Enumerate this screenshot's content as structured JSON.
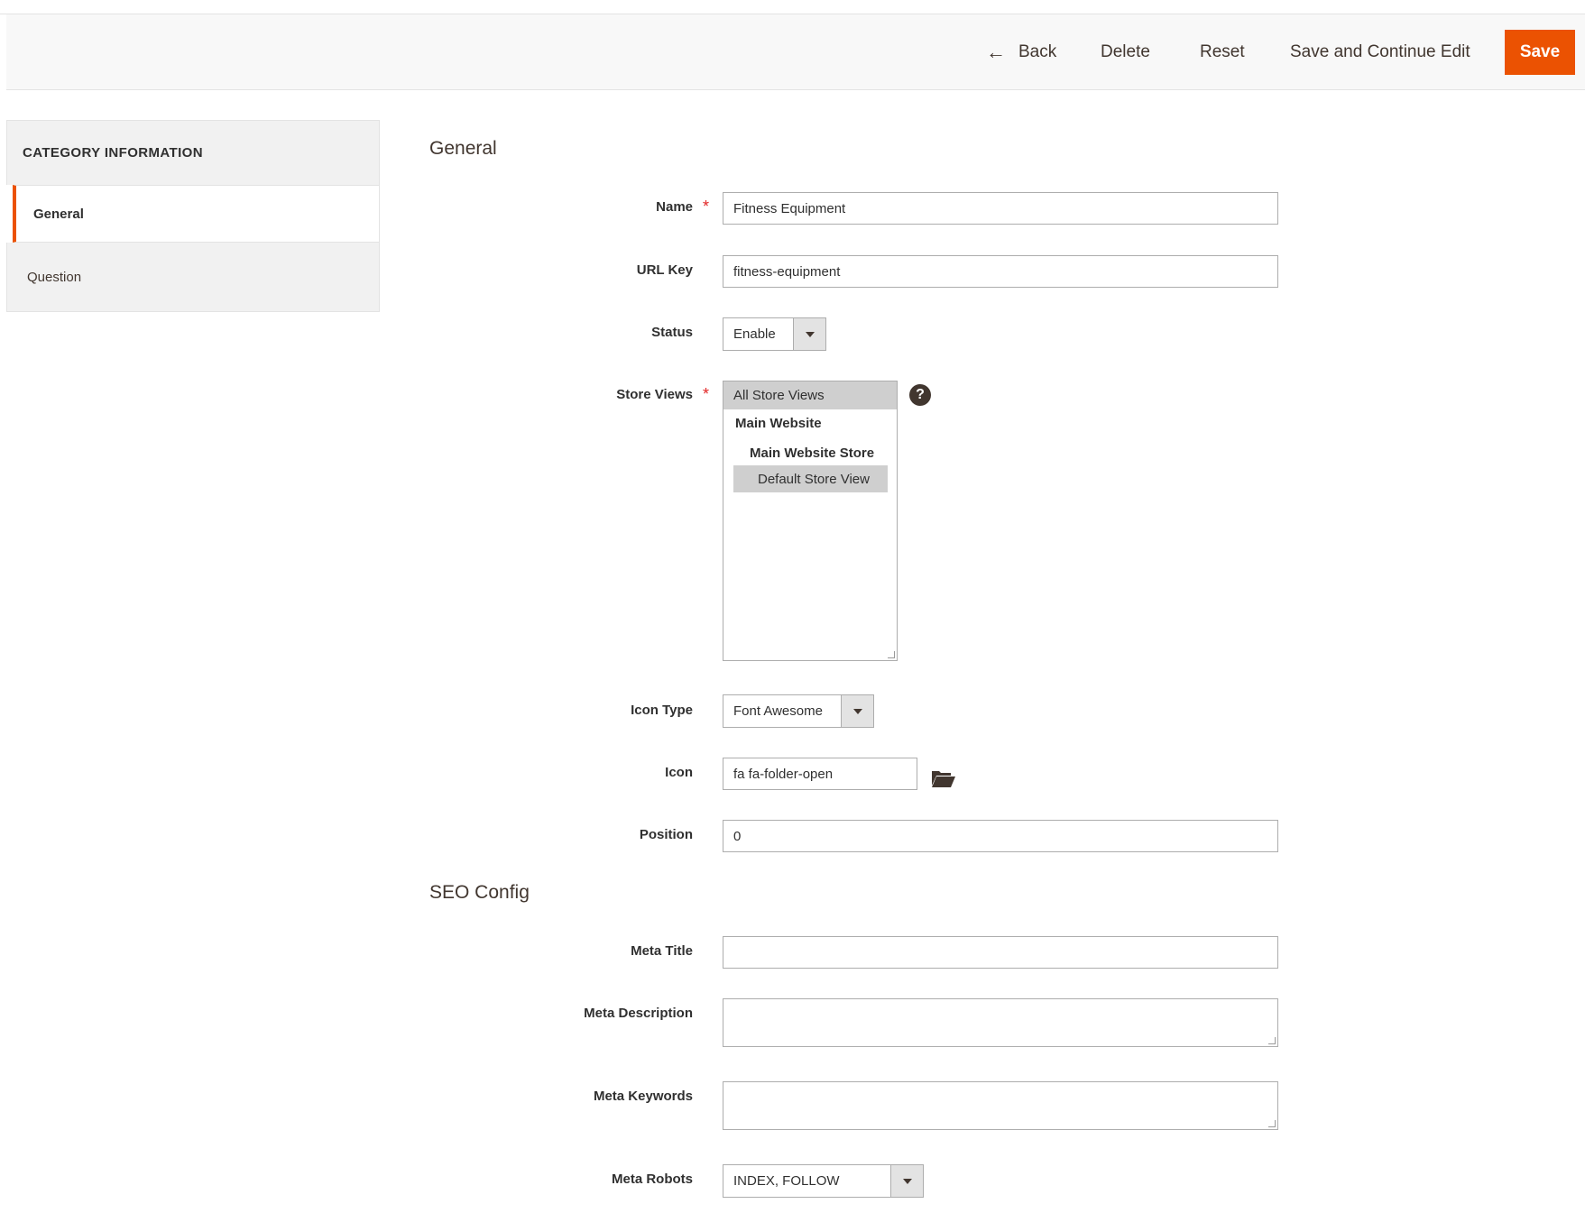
{
  "toolbar": {
    "back_label": "Back",
    "delete_label": "Delete",
    "reset_label": "Reset",
    "save_continue_label": "Save and Continue Edit",
    "save_label": "Save"
  },
  "sidebar": {
    "title": "CATEGORY INFORMATION",
    "items": [
      {
        "label": "General",
        "active": true
      },
      {
        "label": "Question",
        "active": false
      }
    ]
  },
  "sections": {
    "general_title": "General",
    "seo_title": "SEO Config"
  },
  "form": {
    "name": {
      "label": "Name",
      "value": "Fitness Equipment",
      "required": true
    },
    "url_key": {
      "label": "URL Key",
      "value": "fitness-equipment"
    },
    "status": {
      "label": "Status",
      "value": "Enable"
    },
    "store_views": {
      "label": "Store Views",
      "required": true,
      "options": {
        "all": "All Store Views",
        "website": "Main Website",
        "store": "Main Website Store",
        "view": "Default Store View"
      },
      "selected": [
        "All Store Views",
        "Default Store View"
      ],
      "help_icon": "question-circle-icon"
    },
    "icon_type": {
      "label": "Icon Type",
      "value": "Font Awesome"
    },
    "icon": {
      "label": "Icon",
      "value": "fa fa-folder-open",
      "picker_icon": "folder-open-icon"
    },
    "position": {
      "label": "Position",
      "value": "0"
    },
    "meta_title": {
      "label": "Meta Title",
      "value": ""
    },
    "meta_description": {
      "label": "Meta Description",
      "value": ""
    },
    "meta_keywords": {
      "label": "Meta Keywords",
      "value": ""
    },
    "meta_robots": {
      "label": "Meta Robots",
      "value": "INDEX, FOLLOW"
    }
  },
  "colors": {
    "accent": "#eb5202",
    "required": "#e22626",
    "text": "#303030"
  }
}
